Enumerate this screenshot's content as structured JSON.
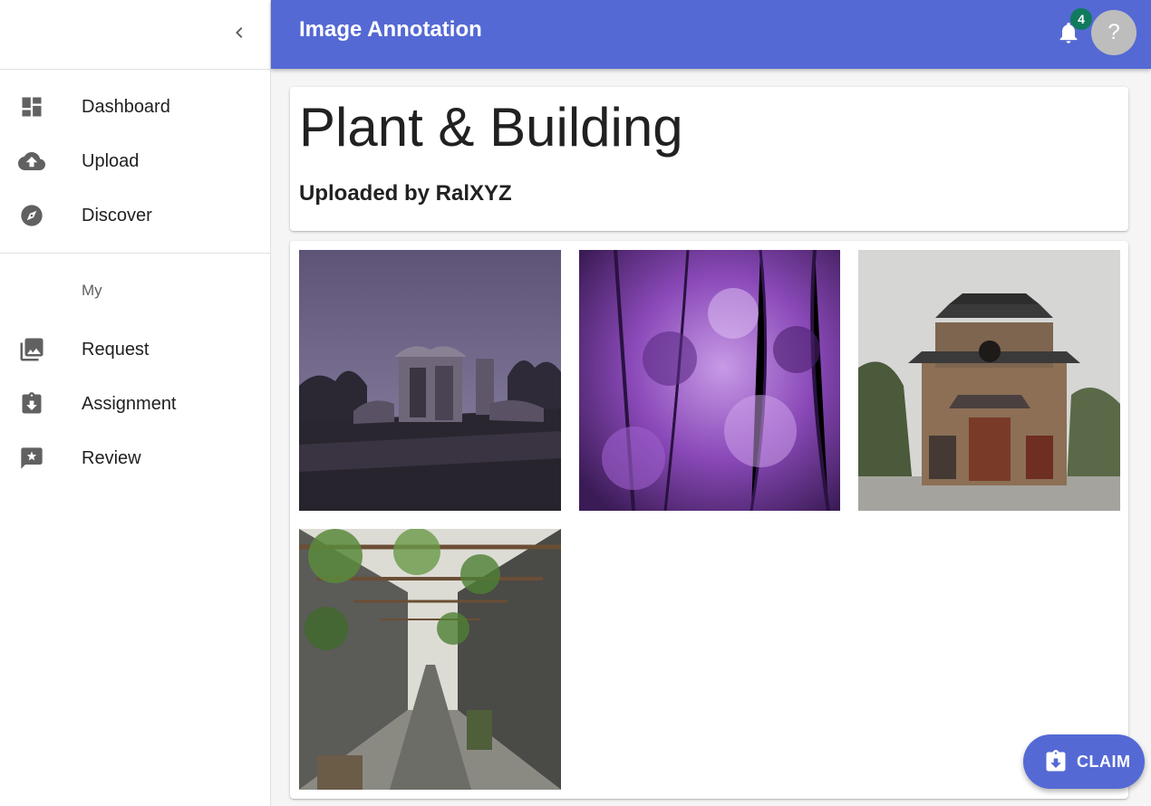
{
  "app": {
    "title": "Image Annotation"
  },
  "sidebar": {
    "collapse_icon": "chevron-left-icon",
    "items": [
      {
        "label": "Dashboard",
        "icon": "dashboard-icon"
      },
      {
        "label": "Upload",
        "icon": "cloud-upload-icon"
      },
      {
        "label": "Discover",
        "icon": "compass-icon"
      }
    ],
    "section_label": "My",
    "my_items": [
      {
        "label": "Request",
        "icon": "photo-library-icon"
      },
      {
        "label": "Assignment",
        "icon": "assignment-return-icon"
      },
      {
        "label": "Review",
        "icon": "rate-review-icon"
      }
    ]
  },
  "header": {
    "notification_count": "4",
    "avatar_text": "?",
    "notification_icon": "bell-icon"
  },
  "album": {
    "title": "Plant & Building",
    "uploaded_by": "Uploaded by RalXYZ"
  },
  "images": [
    {
      "subject": "ruins at dusk"
    },
    {
      "subject": "purple forest"
    },
    {
      "subject": "bell tower"
    },
    {
      "subject": "alley with vines"
    }
  ],
  "fab": {
    "label": "CLAIM",
    "icon": "assignment-return-icon"
  },
  "colors": {
    "primary": "#5469d4",
    "badge": "#0f7a5e",
    "avatar": "#bdbdbd",
    "icon": "#616161"
  }
}
